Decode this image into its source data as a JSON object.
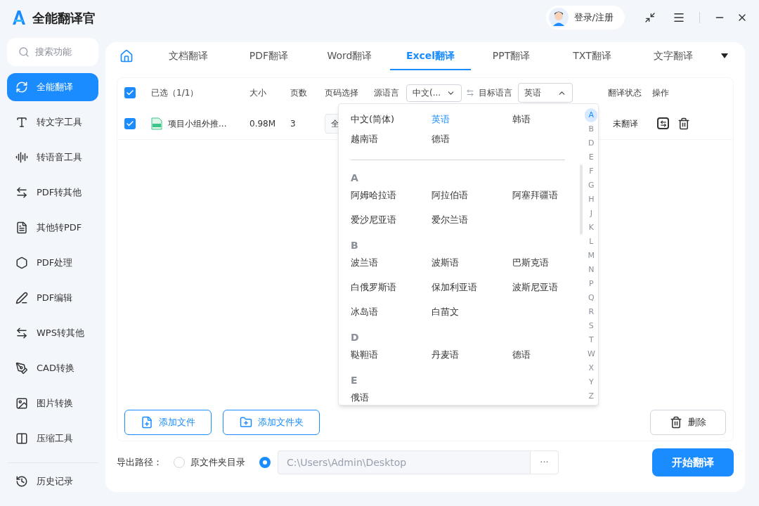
{
  "app": {
    "title": "全能翻译官",
    "login": "登录/注册"
  },
  "sidebar": {
    "search_placeholder": "搜索功能",
    "items": [
      {
        "label": "全能翻译",
        "selected": true
      },
      {
        "label": "转文字工具",
        "selected": false
      },
      {
        "label": "转语音工具",
        "selected": false
      },
      {
        "label": "PDF转其他",
        "selected": false
      },
      {
        "label": "其他转PDF",
        "selected": false
      },
      {
        "label": "PDF处理",
        "selected": false
      },
      {
        "label": "PDF编辑",
        "selected": false
      },
      {
        "label": "WPS转其他",
        "selected": false
      },
      {
        "label": "CAD转换",
        "selected": false
      },
      {
        "label": "图片转换",
        "selected": false
      },
      {
        "label": "压缩工具",
        "selected": false
      }
    ],
    "history": "历史记录"
  },
  "tabs": [
    {
      "label": "文档翻译",
      "selected": false
    },
    {
      "label": "PDF翻译",
      "selected": false
    },
    {
      "label": "Word翻译",
      "selected": false
    },
    {
      "label": "Excel翻译",
      "selected": true
    },
    {
      "label": "PPT翻译",
      "selected": false
    },
    {
      "label": "TXT翻译",
      "selected": false
    },
    {
      "label": "文字翻译",
      "selected": false
    }
  ],
  "table": {
    "select_all": true,
    "columns": [
      "已选（1/1）",
      "大小",
      "页数",
      "页码选择",
      "源语言",
      "目标语言",
      "翻译状态",
      "操作"
    ],
    "source_language": "中文(...",
    "target_language": "英语",
    "rows": [
      {
        "checked": true,
        "name": "项目小组外推...",
        "size": "0.98M",
        "pages": "3",
        "page_select": "全",
        "status": "未翻译"
      }
    ]
  },
  "dropdown": {
    "common": [
      {
        "label": "中文(简体)",
        "selected": false
      },
      {
        "label": "英语",
        "selected": true
      },
      {
        "label": "韩语",
        "selected": false
      },
      {
        "label": "越南语",
        "selected": false
      },
      {
        "label": "德语",
        "selected": false
      }
    ],
    "groups": [
      {
        "letter": "A",
        "languages": [
          "阿姆哈拉语",
          "阿拉伯语",
          "阿塞拜疆语",
          "爱沙尼亚语",
          "爱尔兰语"
        ]
      },
      {
        "letter": "B",
        "languages": [
          "波兰语",
          "波斯语",
          "巴斯克语",
          "白俄罗斯语",
          "保加利亚语",
          "波斯尼亚语",
          "冰岛语",
          "白苗文"
        ]
      },
      {
        "letter": "D",
        "languages": [
          "鞑靼语",
          "丹麦语",
          "德语"
        ]
      },
      {
        "letter": "E",
        "languages": [
          "俄语"
        ]
      }
    ],
    "index": [
      {
        "letter": "A",
        "selected": true
      },
      {
        "letter": "B",
        "selected": false
      },
      {
        "letter": "D",
        "selected": false
      },
      {
        "letter": "E",
        "selected": false
      },
      {
        "letter": "F",
        "selected": false
      },
      {
        "letter": "G",
        "selected": false
      },
      {
        "letter": "H",
        "selected": false
      },
      {
        "letter": "J",
        "selected": false
      },
      {
        "letter": "K",
        "selected": false
      },
      {
        "letter": "L",
        "selected": false
      },
      {
        "letter": "M",
        "selected": false
      },
      {
        "letter": "N",
        "selected": false
      },
      {
        "letter": "P",
        "selected": false
      },
      {
        "letter": "Q",
        "selected": false
      },
      {
        "letter": "R",
        "selected": false
      },
      {
        "letter": "S",
        "selected": false
      },
      {
        "letter": "T",
        "selected": false
      },
      {
        "letter": "W",
        "selected": false
      },
      {
        "letter": "X",
        "selected": false
      },
      {
        "letter": "Y",
        "selected": false
      },
      {
        "letter": "Z",
        "selected": false
      }
    ]
  },
  "actions": {
    "add_file": "添加文件",
    "add_folder": "添加文件夹",
    "delete": "删除"
  },
  "export": {
    "label": "导出路径：",
    "options": [
      {
        "label": "原文件夹目录",
        "selected": false
      }
    ],
    "custom_selected": true,
    "path": "C:\\Users\\Admin\\Desktop",
    "browse": "···",
    "start": "开始翻译"
  }
}
